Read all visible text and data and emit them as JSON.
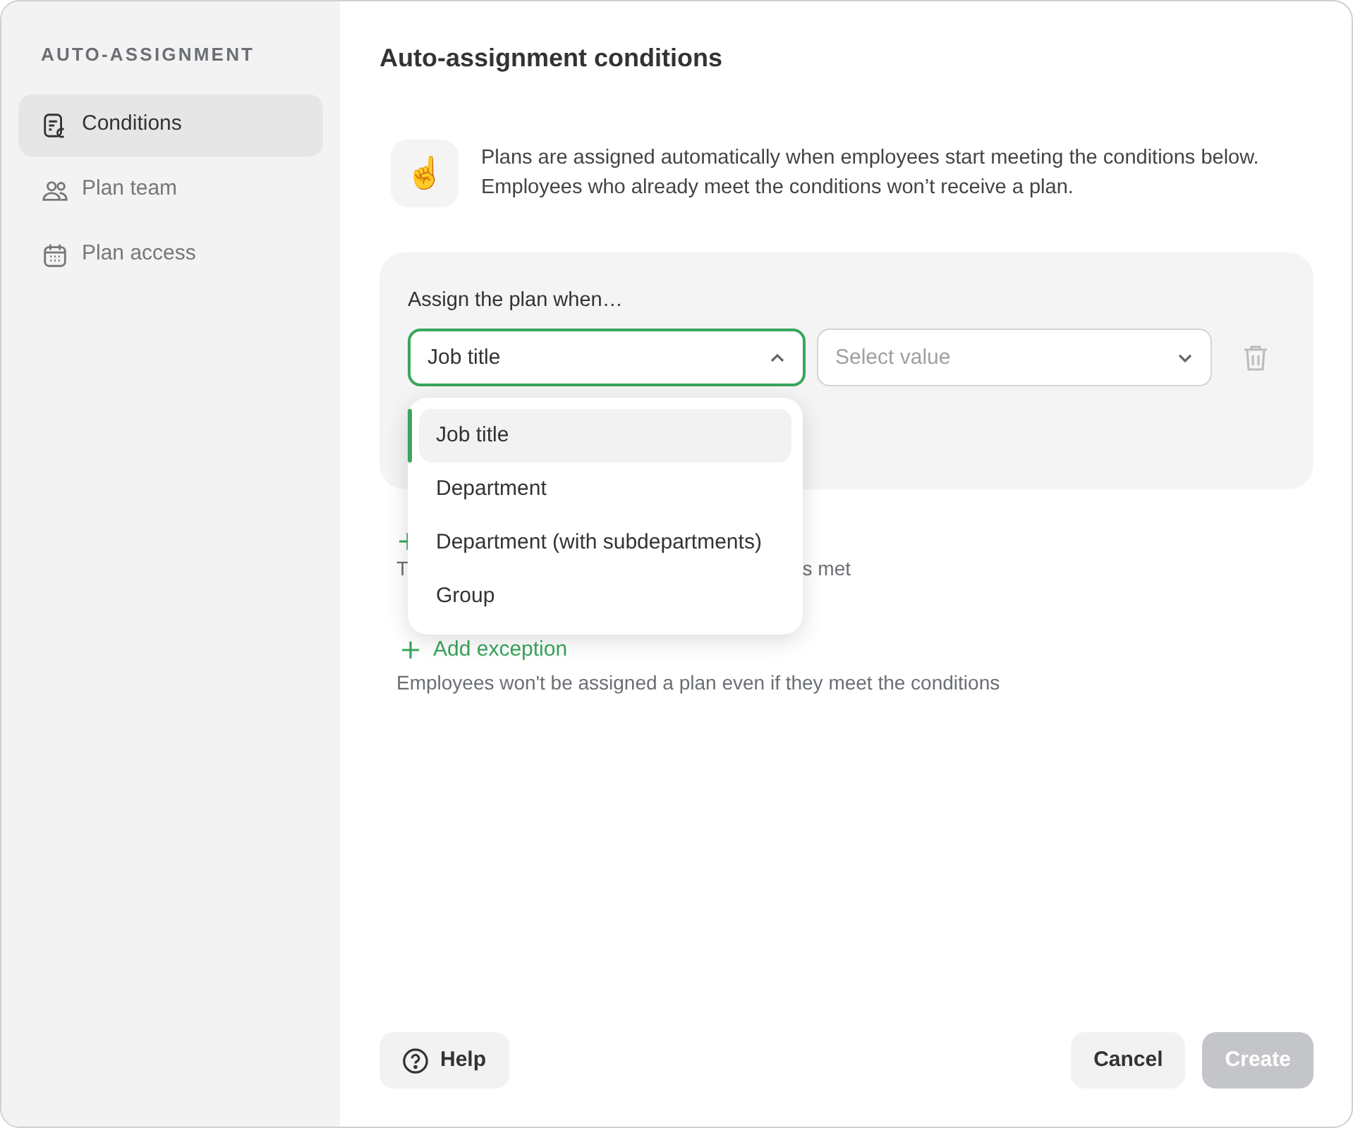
{
  "sidebar": {
    "title": "AUTO-ASSIGNMENT",
    "items": [
      {
        "label": "Conditions",
        "selected": true
      },
      {
        "label": "Plan team",
        "selected": false
      },
      {
        "label": "Plan access",
        "selected": false
      }
    ]
  },
  "title": "Auto-assignment conditions",
  "info": {
    "emoji": "☝️",
    "text": "Plans are assigned automatically when employees start meeting the conditions below. Employees who already meet the conditions won’t receive a plan."
  },
  "condition": {
    "label": "Assign the plan when…",
    "field": {
      "value": "Job title",
      "expanded": true
    },
    "value_select": {
      "placeholder": "Select value"
    }
  },
  "hint_fragments": [
    "T",
    "s met"
  ],
  "exception": {
    "label": "Add exception",
    "hint": "Employees won't be assigned a plan even if they meet the conditions"
  },
  "dropdown": [
    {
      "label": "Job title",
      "selected": true
    },
    {
      "label": "Department",
      "selected": false
    },
    {
      "label": "Department (with subdepartments)",
      "selected": false
    },
    {
      "label": "Group",
      "selected": false
    }
  ],
  "footer": {
    "help": "Help",
    "cancel": "Cancel",
    "create": {
      "label": "Create",
      "disabled": true
    }
  }
}
